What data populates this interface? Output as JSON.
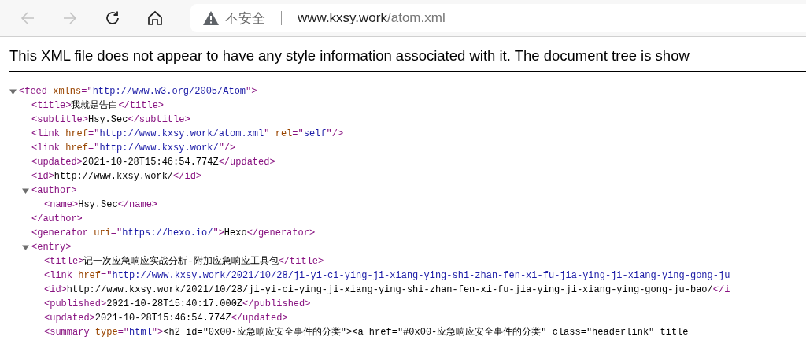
{
  "toolbar": {
    "back": {
      "disabled": true
    },
    "forward": {
      "disabled": true
    },
    "address": {
      "security": "不安全",
      "host": "www.kxsy.work",
      "path": "/atom.xml"
    }
  },
  "notice": "This XML file does not appear to have any style information associated with it. The document tree is show",
  "tree": [
    {
      "expanded": true,
      "tokens": [
        {
          "kind": "tag",
          "text": "<feed "
        },
        {
          "kind": "attr",
          "text": "xmlns"
        },
        {
          "kind": "tag",
          "text": "=\""
        },
        {
          "kind": "value",
          "text": "http://www.w3.org/2005/Atom"
        },
        {
          "kind": "tag",
          "text": "\">"
        }
      ],
      "children": [
        {
          "tokens": [
            {
              "kind": "tag",
              "text": "<title>"
            },
            {
              "kind": "text",
              "text": "我就是告白"
            },
            {
              "kind": "tag",
              "text": "</title>"
            }
          ]
        },
        {
          "tokens": [
            {
              "kind": "tag",
              "text": "<subtitle>"
            },
            {
              "kind": "text",
              "text": "Hsy.Sec"
            },
            {
              "kind": "tag",
              "text": "</subtitle>"
            }
          ]
        },
        {
          "tokens": [
            {
              "kind": "tag",
              "text": "<link "
            },
            {
              "kind": "attr",
              "text": "href"
            },
            {
              "kind": "tag",
              "text": "=\""
            },
            {
              "kind": "value",
              "text": "http://www.kxsy.work/atom.xml"
            },
            {
              "kind": "tag",
              "text": "\" "
            },
            {
              "kind": "attr",
              "text": "rel"
            },
            {
              "kind": "tag",
              "text": "=\""
            },
            {
              "kind": "value",
              "text": "self"
            },
            {
              "kind": "tag",
              "text": "\"/>"
            }
          ]
        },
        {
          "tokens": [
            {
              "kind": "tag",
              "text": "<link "
            },
            {
              "kind": "attr",
              "text": "href"
            },
            {
              "kind": "tag",
              "text": "=\""
            },
            {
              "kind": "value",
              "text": "http://www.kxsy.work/"
            },
            {
              "kind": "tag",
              "text": "\"/>"
            }
          ]
        },
        {
          "tokens": [
            {
              "kind": "tag",
              "text": "<updated>"
            },
            {
              "kind": "text",
              "text": "2021-10-28T15:46:54.774Z"
            },
            {
              "kind": "tag",
              "text": "</updated>"
            }
          ]
        },
        {
          "tokens": [
            {
              "kind": "tag",
              "text": "<id>"
            },
            {
              "kind": "text",
              "text": "http://www.kxsy.work/"
            },
            {
              "kind": "tag",
              "text": "</id>"
            }
          ]
        },
        {
          "expanded": true,
          "tokens": [
            {
              "kind": "tag",
              "text": "<author>"
            }
          ],
          "children": [
            {
              "tokens": [
                {
                  "kind": "tag",
                  "text": "<name>"
                },
                {
                  "kind": "text",
                  "text": "Hsy.Sec"
                },
                {
                  "kind": "tag",
                  "text": "</name>"
                }
              ]
            }
          ],
          "close": [
            {
              "kind": "tag",
              "text": "</author>"
            }
          ]
        },
        {
          "tokens": [
            {
              "kind": "tag",
              "text": "<generator "
            },
            {
              "kind": "attr",
              "text": "uri"
            },
            {
              "kind": "tag",
              "text": "=\""
            },
            {
              "kind": "value",
              "text": "https://hexo.io/"
            },
            {
              "kind": "tag",
              "text": "\">"
            },
            {
              "kind": "text",
              "text": "Hexo"
            },
            {
              "kind": "tag",
              "text": "</generator>"
            }
          ]
        },
        {
          "expanded": true,
          "tokens": [
            {
              "kind": "tag",
              "text": "<entry>"
            }
          ],
          "children": [
            {
              "tokens": [
                {
                  "kind": "tag",
                  "text": "<title>"
                },
                {
                  "kind": "text",
                  "text": "记一次应急响应实战分析-附加应急响应工具包"
                },
                {
                  "kind": "tag",
                  "text": "</title>"
                }
              ]
            },
            {
              "tokens": [
                {
                  "kind": "tag",
                  "text": "<link "
                },
                {
                  "kind": "attr",
                  "text": "href"
                },
                {
                  "kind": "tag",
                  "text": "=\""
                },
                {
                  "kind": "value",
                  "text": "http://www.kxsy.work/2021/10/28/ji-yi-ci-ying-ji-xiang-ying-shi-zhan-fen-xi-fu-jia-ying-ji-xiang-ying-gong-ju"
                }
              ]
            },
            {
              "tokens": [
                {
                  "kind": "tag",
                  "text": "<id>"
                },
                {
                  "kind": "text",
                  "text": "http://www.kxsy.work/2021/10/28/ji-yi-ci-ying-ji-xiang-ying-shi-zhan-fen-xi-fu-jia-ying-ji-xiang-ying-gong-ju-bao/"
                },
                {
                  "kind": "tag",
                  "text": "</i"
                }
              ]
            },
            {
              "tokens": [
                {
                  "kind": "tag",
                  "text": "<published>"
                },
                {
                  "kind": "text",
                  "text": "2021-10-28T15:40:17.000Z"
                },
                {
                  "kind": "tag",
                  "text": "</published>"
                }
              ]
            },
            {
              "tokens": [
                {
                  "kind": "tag",
                  "text": "<updated>"
                },
                {
                  "kind": "text",
                  "text": "2021-10-28T15:46:54.774Z"
                },
                {
                  "kind": "tag",
                  "text": "</updated>"
                }
              ]
            },
            {
              "tokens": [
                {
                  "kind": "tag",
                  "text": "<summary "
                },
                {
                  "kind": "attr",
                  "text": "type"
                },
                {
                  "kind": "tag",
                  "text": "=\""
                },
                {
                  "kind": "value",
                  "text": "html"
                },
                {
                  "kind": "tag",
                  "text": "\">"
                },
                {
                  "kind": "text",
                  "text": "<h2 id=\"0x00-应急响应安全事件的分类\"><a href=\"#0x00-应急响应安全事件的分类\" class=\"headerlink\" title"
                }
              ]
            }
          ]
        }
      ]
    }
  ]
}
